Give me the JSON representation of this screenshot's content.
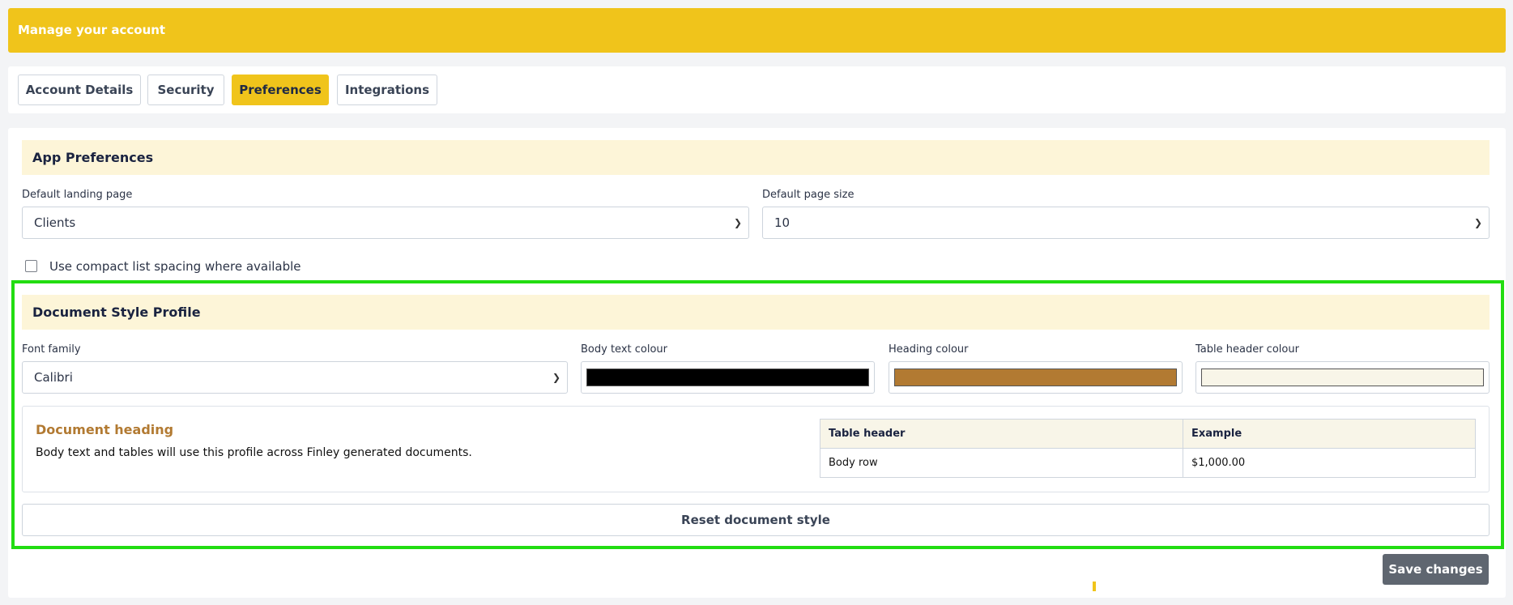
{
  "header": {
    "title": "Manage your account"
  },
  "tabs": [
    {
      "label": "Account Details",
      "active": false
    },
    {
      "label": "Security",
      "active": false
    },
    {
      "label": "Preferences",
      "active": true
    },
    {
      "label": "Integrations",
      "active": false
    }
  ],
  "app_preferences": {
    "title": "App Preferences",
    "landing_page_label": "Default landing page",
    "landing_page_value": "Clients",
    "page_size_label": "Default page size",
    "page_size_value": "10",
    "compact_label": "Use compact list spacing where available",
    "compact_checked": false
  },
  "document_style": {
    "title": "Document Style Profile",
    "font_family_label": "Font family",
    "font_family_value": "Calibri",
    "body_colour_label": "Body text colour",
    "body_colour": "#000000",
    "heading_colour_label": "Heading colour",
    "heading_colour": "#b27a32",
    "table_header_colour_label": "Table header colour",
    "table_header_colour": "#f8f5e8",
    "preview": {
      "heading": "Document heading",
      "body": "Body text and tables will use this profile across Finley generated documents.",
      "table_headers": [
        "Table header",
        "Example"
      ],
      "table_row": [
        "Body row",
        "$1,000.00"
      ]
    },
    "reset_label": "Reset document style"
  },
  "save_label": "Save changes",
  "colors": {
    "accent": "#f0c41b",
    "section_bg": "#fdf5d8",
    "highlight": "#22dd11",
    "save_bg": "#5f6670"
  }
}
